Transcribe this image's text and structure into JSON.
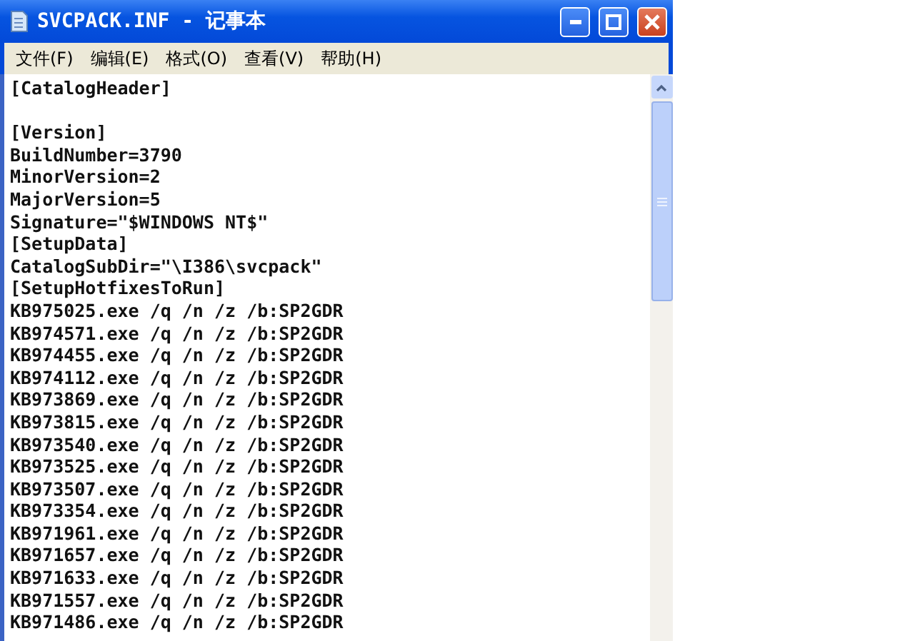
{
  "window": {
    "title": "SVCPACK.INF - 记事本"
  },
  "menu": [
    "文件(F)",
    "编辑(E)",
    "格式(O)",
    "查看(V)",
    "帮助(H)"
  ],
  "editor": {
    "lines": [
      {
        "kind": "text",
        "text": "[CatalogHeader]"
      },
      {
        "kind": "blank"
      },
      {
        "kind": "text",
        "text": "[Version]"
      },
      {
        "kind": "text",
        "text": "BuildNumber=3790"
      },
      {
        "kind": "text",
        "text": "MinorVersion=2"
      },
      {
        "kind": "text",
        "text": "MajorVersion=5"
      },
      {
        "kind": "text",
        "text": "Signature=\"$WINDOWS NT$\""
      },
      {
        "kind": "text",
        "text": "[SetupData]"
      },
      {
        "kind": "text",
        "text": "CatalogSubDir=\"\\I386\\svcpack\""
      },
      {
        "kind": "text",
        "text": "[SetupHotfixesToRun]"
      },
      {
        "kind": "text",
        "text": "KB975025.exe /q /n /z /b:SP2GDR"
      },
      {
        "kind": "text",
        "text": "KB974571.exe /q /n /z /b:SP2GDR"
      },
      {
        "kind": "text",
        "text": "KB974455.exe /q /n /z /b:SP2GDR"
      },
      {
        "kind": "text",
        "text": "KB974112.exe /q /n /z /b:SP2GDR"
      },
      {
        "kind": "text",
        "text": "KB973869.exe /q /n /z /b:SP2GDR"
      },
      {
        "kind": "text",
        "text": "KB973815.exe /q /n /z /b:SP2GDR"
      },
      {
        "kind": "text",
        "text": "KB973540.exe /q /n /z /b:SP2GDR"
      },
      {
        "kind": "text",
        "text": "KB973525.exe /q /n /z /b:SP2GDR"
      },
      {
        "kind": "text",
        "text": "KB973507.exe /q /n /z /b:SP2GDR"
      },
      {
        "kind": "text",
        "text": "KB973354.exe /q /n /z /b:SP2GDR"
      },
      {
        "kind": "text",
        "text": "KB971961.exe /q /n /z /b:SP2GDR"
      },
      {
        "kind": "text",
        "text": "KB971657.exe /q /n /z /b:SP2GDR"
      },
      {
        "kind": "text",
        "text": "KB971633.exe /q /n /z /b:SP2GDR"
      },
      {
        "kind": "text",
        "text": "KB971557.exe /q /n /z /b:SP2GDR"
      },
      {
        "kind": "text",
        "text": "KB971486.exe /q /n /z /b:SP2GDR"
      }
    ]
  }
}
